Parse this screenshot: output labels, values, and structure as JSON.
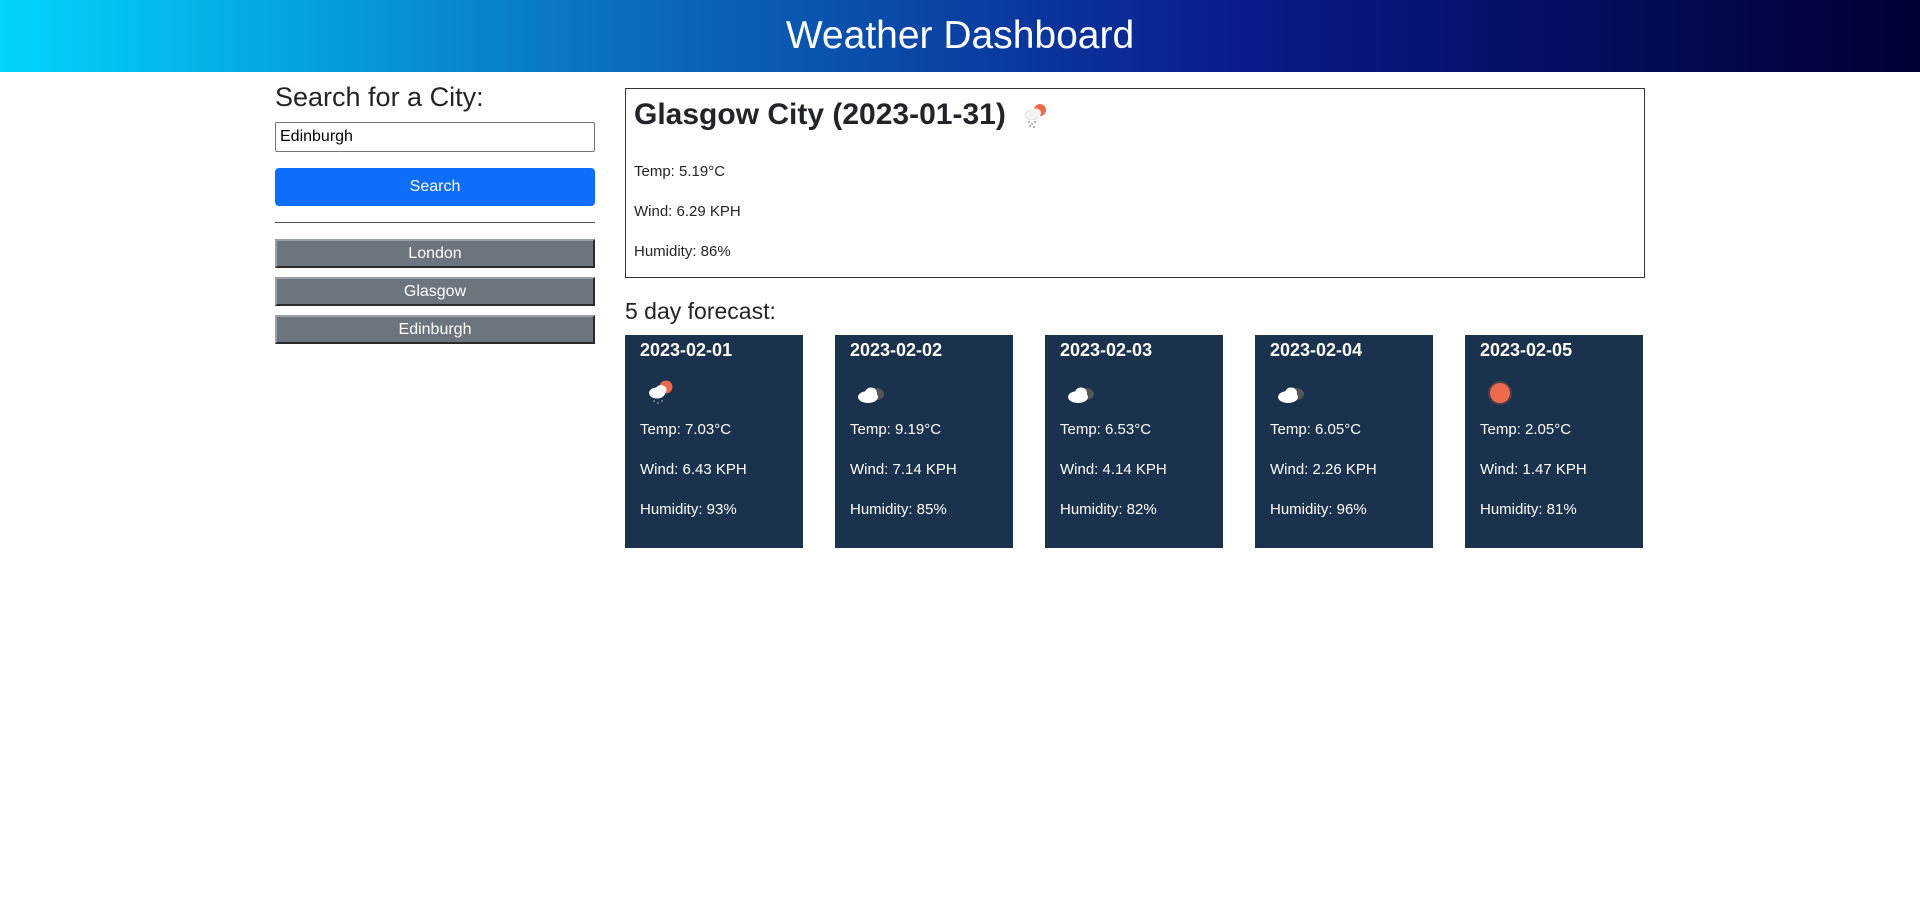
{
  "header": {
    "title": "Weather Dashboard"
  },
  "sidebar": {
    "heading": "Search for a City:",
    "search_input": {
      "value": "Edinburgh",
      "placeholder": ""
    },
    "search_label": "Search",
    "history": [
      "London",
      "Glasgow",
      "Edinburgh"
    ]
  },
  "current": {
    "title": "Glasgow City (2023-01-31)",
    "icon": "sun-cloud-rain-icon",
    "temp": "Temp: 5.19°C",
    "wind": "Wind: 6.29 KPH",
    "humidity": "Humidity: 86%"
  },
  "forecast": {
    "heading": "5 day forecast:",
    "days": [
      {
        "date": "2023-02-01",
        "icon": "sun-cloud-rain-icon",
        "temp": "Temp: 7.03°C",
        "wind": "Wind: 6.43 KPH",
        "humidity": "Humidity: 93%"
      },
      {
        "date": "2023-02-02",
        "icon": "cloud-icon",
        "temp": "Temp: 9.19°C",
        "wind": "Wind: 7.14 KPH",
        "humidity": "Humidity: 85%"
      },
      {
        "date": "2023-02-03",
        "icon": "cloud-icon",
        "temp": "Temp: 6.53°C",
        "wind": "Wind: 4.14 KPH",
        "humidity": "Humidity: 82%"
      },
      {
        "date": "2023-02-04",
        "icon": "cloud-icon",
        "temp": "Temp: 6.05°C",
        "wind": "Wind: 2.26 KPH",
        "humidity": "Humidity: 96%"
      },
      {
        "date": "2023-02-05",
        "icon": "sun-icon",
        "temp": "Temp: 2.05°C",
        "wind": "Wind: 1.47 KPH",
        "humidity": "Humidity: 81%"
      }
    ]
  },
  "colors": {
    "header_gradient": [
      "#00d4ff",
      "#0a74c4",
      "#0a1a8a",
      "#000033"
    ],
    "search_button": "#0d6efd",
    "history_button": "#6c757d",
    "forecast_card": "#1a324d",
    "sun": "#ef6a4c"
  }
}
